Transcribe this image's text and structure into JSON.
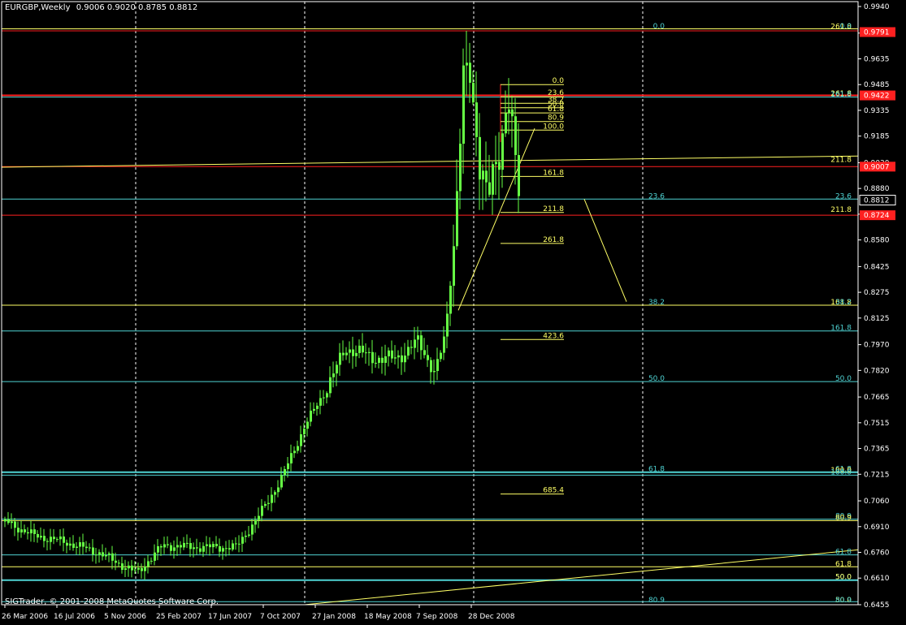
{
  "header": {
    "symbol_timeframe": "EURGBP,Weekly",
    "ohlc": "0.9006 0.9020 0.8785 0.8812"
  },
  "copyright": "SIGTrader, © 2001-2008 MetaQuotes Software Corp.",
  "colors": {
    "background": "#000000",
    "frame": "#ffffff",
    "candle": "#66ff44",
    "fib_yellow": "#ffff66",
    "fib_cyan": "#4fd3d3",
    "level_red": "#ff2020",
    "price_box_red": "#ff2020",
    "price_box_white": "#000000"
  },
  "chart_data": {
    "type": "candlestick",
    "y_axis_ticks": [
      "0.9940",
      "0.9785",
      "0.9635",
      "0.9485",
      "0.9335",
      "0.9185",
      "0.9030",
      "0.8880",
      "0.8730",
      "0.8580",
      "0.8425",
      "0.8275",
      "0.8125",
      "0.7970",
      "0.7820",
      "0.7665",
      "0.7515",
      "0.7365",
      "0.7215",
      "0.7060",
      "0.6910",
      "0.6760",
      "0.6610",
      "0.6455"
    ],
    "x_axis_ticks": [
      "26 Mar 2006",
      "16 Jul 2006",
      "5 Nov 2006",
      "25 Feb 2007",
      "17 Jun 2007",
      "7 Oct 2007",
      "27 Jan 2008",
      "18 May 2008",
      "7 Sep 2008",
      "28 Dec 2008"
    ],
    "ylim": [
      0.6455,
      0.994
    ],
    "current_price": "0.8812",
    "price_labels_red": [
      "0.9791",
      "0.9422",
      "0.9007",
      "0.8724"
    ],
    "fib_levels_right": [
      {
        "label": "261.8",
        "value": 0.9805,
        "color": "yellow"
      },
      {
        "label": "0.0",
        "value": 0.9808,
        "color": "cyan"
      },
      {
        "label": "261.8",
        "value": 0.9416,
        "color": "yellow"
      },
      {
        "label": "161.8",
        "value": 0.941,
        "color": "cyan"
      },
      {
        "label": "211.8",
        "value": 0.903,
        "color": "yellow"
      },
      {
        "label": "23.6",
        "value": 0.8818,
        "color": "cyan"
      },
      {
        "label": "211.8",
        "value": 0.874,
        "color": "yellow"
      },
      {
        "label": "161.8",
        "value": 0.82,
        "color": "yellow"
      },
      {
        "label": "38.2",
        "value": 0.82,
        "color": "cyan"
      },
      {
        "label": "161.8",
        "value": 0.805,
        "color": "cyan"
      },
      {
        "label": "50.0",
        "value": 0.7755,
        "color": "cyan"
      },
      {
        "label": "61.8",
        "value": 0.7227,
        "color": "cyan"
      },
      {
        "label": "100.0",
        "value": 0.722,
        "color": "yellow"
      },
      {
        "label": "100.0",
        "value": 0.721,
        "color": "cyan"
      },
      {
        "label": "80.9",
        "value": 0.6953,
        "color": "cyan"
      },
      {
        "label": "80.9",
        "value": 0.6945,
        "color": "yellow"
      },
      {
        "label": "61.8",
        "value": 0.6745,
        "color": "cyan"
      },
      {
        "label": "61.8",
        "value": 0.6676,
        "color": "yellow"
      },
      {
        "label": "50.0",
        "value": 0.66,
        "color": "cyan"
      },
      {
        "label": "50.0",
        "value": 0.66,
        "color": "yellow"
      },
      {
        "label": "50.0",
        "value": 0.6465,
        "color": "yellow"
      },
      {
        "label": "80.9",
        "value": 0.6465,
        "color": "cyan"
      }
    ],
    "fib_labels_center": [
      {
        "label": "0.0",
        "value": 0.9808
      },
      {
        "label": "23.6",
        "value": 0.8818
      },
      {
        "label": "38.2",
        "value": 0.82
      },
      {
        "label": "50.0",
        "value": 0.7755
      },
      {
        "label": "61.8",
        "value": 0.7227
      },
      {
        "label": "80.9",
        "value": 0.6465
      }
    ],
    "fib_labels_local": [
      {
        "label": "0.0",
        "value": 0.9485
      },
      {
        "label": "23.6",
        "value": 0.9414
      },
      {
        "label": "38.2",
        "value": 0.9376
      },
      {
        "label": "50.0",
        "value": 0.935
      },
      {
        "label": "61.8",
        "value": 0.932
      },
      {
        "label": "80.9",
        "value": 0.927
      },
      {
        "label": "100.0",
        "value": 0.922
      },
      {
        "label": "161.8",
        "value": 0.895
      },
      {
        "label": "211.8",
        "value": 0.874
      },
      {
        "label": "261.8",
        "value": 0.856
      },
      {
        "label": "423.6",
        "value": 0.8
      },
      {
        "label": "685.4",
        "value": 0.71
      }
    ]
  }
}
